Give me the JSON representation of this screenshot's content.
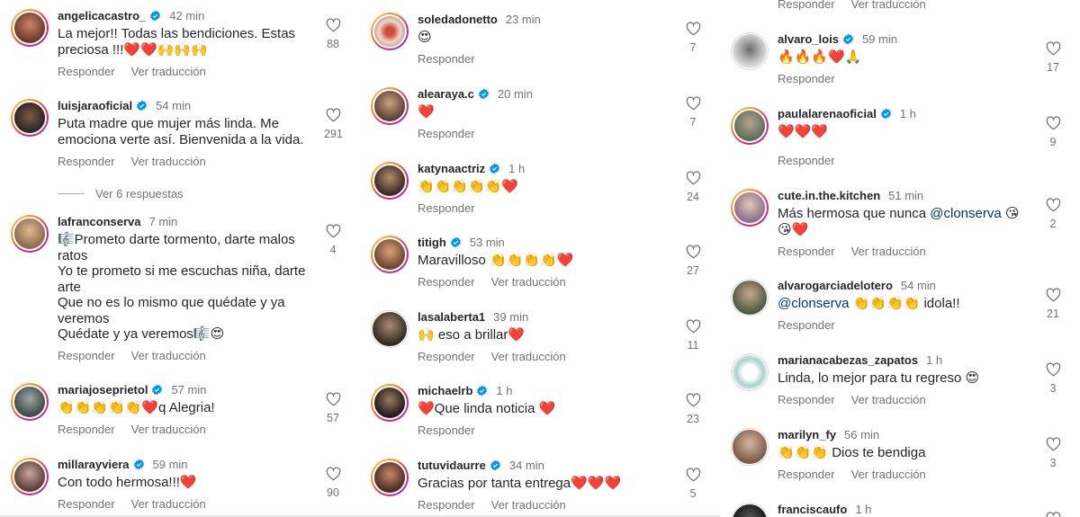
{
  "labels": {
    "reply": "Responder",
    "translate": "Ver traducción",
    "view_replies": "Ver 6 respuestas"
  },
  "columns": [
    {
      "comments": [
        {
          "user": "angelicacastro_",
          "verified": true,
          "time": "42 min",
          "text": "La mejor!! Todas las bendiciones. Estas preciosa !!!❤️❤️🙌🙌🙌",
          "likes": "88",
          "translate": true
        },
        {
          "user": "luisjaraoficial",
          "verified": true,
          "time": "54 min",
          "text": "Puta madre que mujer más linda.  Me emociona verte así.  Bienvenida a la vida.",
          "likes": "291",
          "translate": true
        },
        {
          "user": "lafranconserva",
          "verified": false,
          "time": "7 min",
          "text": "🎼Prometo darte tormento, darte malos ratos\nYo te prometo si me escuchas niña, darte arte\nQue no es lo mismo que quédate y ya veremos\nQuédate y ya veremos🎼😍",
          "likes": "4",
          "translate": true
        },
        {
          "user": "mariajoseprietol",
          "verified": true,
          "time": "57 min",
          "text": "👏👏👏👏👏❤️q Alegria!",
          "likes": "57",
          "translate": true
        },
        {
          "user": "millarayviera",
          "verified": true,
          "time": "59 min",
          "text": "Con todo hermosa!!!❤️",
          "likes": "90",
          "translate": true
        }
      ]
    },
    {
      "comments": [
        {
          "user": "soledadonetto",
          "verified": false,
          "time": "23 min",
          "text": "😍",
          "likes": "7",
          "translate": false
        },
        {
          "user": "alearaya.c",
          "verified": true,
          "time": "20 min",
          "text": "❤️",
          "likes": "7",
          "translate": false
        },
        {
          "user": "katynaactriz",
          "verified": true,
          "time": "1 h",
          "text": "👏👏👏👏👏❤️",
          "likes": "24",
          "translate": false
        },
        {
          "user": "titigh",
          "verified": true,
          "time": "53 min",
          "text": "Maravilloso 👏👏👏👏❤️",
          "likes": "27",
          "translate": true
        },
        {
          "user": "lasalaberta1",
          "verified": false,
          "time": "39 min",
          "text": "🙌 eso a brillar❤️",
          "likes": "11",
          "translate": true
        },
        {
          "user": "michaelrb",
          "verified": true,
          "time": "1 h",
          "text": "❤️Que linda noticia ❤️",
          "likes": "23",
          "translate": false
        },
        {
          "user": "tutuvidaurre",
          "verified": true,
          "time": "34 min",
          "text": "Gracias por tanta entrega❤️❤️❤️",
          "likes": "5",
          "translate": true
        }
      ]
    },
    {
      "top_actions": {
        "reply": "Responder",
        "translate": "Ver traducción"
      },
      "comments": [
        {
          "user": "alvaro_lois",
          "verified": true,
          "time": "59 min",
          "text": "🔥🔥🔥❤️🙏",
          "likes": "17",
          "translate": false
        },
        {
          "user": "paulalarenaoficial",
          "verified": true,
          "time": "1 h",
          "text": "❤️❤️❤️",
          "likes": "9",
          "translate": false
        },
        {
          "user": "cute.in.the.kitchen",
          "verified": false,
          "time": "51 min",
          "text": "Más hermosa que nunca @clonserva 😘😘❤️",
          "likes": "2",
          "translate": true
        },
        {
          "user": "alvarogarciadelotero",
          "verified": false,
          "time": "54 min",
          "text": "@clonserva 👏👏👏👏 idola!!",
          "likes": "21",
          "translate": true
        },
        {
          "user": "marianacabezas_zapatos",
          "verified": false,
          "time": "1 h",
          "text": "Linda, lo mejor para tu regreso 😍",
          "likes": "3",
          "translate": true
        },
        {
          "user": "marilyn_fy",
          "verified": false,
          "time": "56 min",
          "text": "👏👏👏 Dios te bendiga",
          "likes": "3",
          "translate": true
        },
        {
          "user": "franciscaufo",
          "verified": false,
          "time": "1 h",
          "text": "",
          "likes": "",
          "translate": false
        }
      ]
    }
  ],
  "colors": {
    "text": "#262626",
    "secondary": "#737373",
    "verified": "#0095f6",
    "mention": "#00376b"
  }
}
